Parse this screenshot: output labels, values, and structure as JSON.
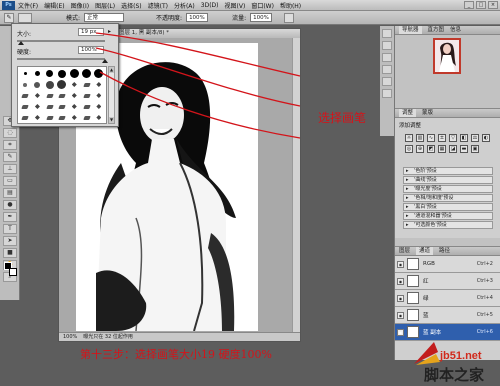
{
  "menubar": {
    "app_badge": "Ps",
    "items": [
      "文件(F)",
      "编辑(E)",
      "图像(I)",
      "图层(L)",
      "选择(S)",
      "滤镜(T)",
      "分析(A)",
      "3D(D)",
      "视图(V)",
      "窗口(W)",
      "帮助(H)"
    ],
    "window_buttons": [
      "_",
      "□",
      "×"
    ]
  },
  "options_bar": {
    "mode_label": "模式:",
    "mode_value": "正常",
    "opacity_label": "不透明度:",
    "opacity_value": "100%",
    "flow_label": "流量:",
    "flow_value": "100%"
  },
  "brush_panel": {
    "size_label": "大小:",
    "size_value": "19 px",
    "hardness_label": "硬度:",
    "hardness_value": "100%",
    "size_fraction": 0.04,
    "hardness_fraction": 1.0
  },
  "document": {
    "title": "图层 1, 黑 副本/8) *",
    "zoom": "100%",
    "status": "曝光只在 32 位起作用"
  },
  "right_panel": {
    "nav_tabs": [
      "导航器",
      "直方图",
      "信息"
    ],
    "adjust_tabs": [
      "调整",
      "蒙版"
    ],
    "adjust_title": "添加调整",
    "presets": [
      "'色阶'预设",
      "'曲线'预设",
      "'曝光度'预设",
      "'色相/饱和度'预设",
      "'黑白'预设",
      "'通道混和器'预设",
      "'可选颜色'预设"
    ],
    "layers_tabs": [
      "图层",
      "通道",
      "路径"
    ],
    "layers": [
      {
        "name": "RGB",
        "shortcut": "Ctrl+2",
        "selected": false
      },
      {
        "name": "红",
        "shortcut": "Ctrl+3",
        "selected": false
      },
      {
        "name": "绿",
        "shortcut": "Ctrl+4",
        "selected": false
      },
      {
        "name": "蓝",
        "shortcut": "Ctrl+5",
        "selected": false
      },
      {
        "name": "蓝 副本",
        "shortcut": "Ctrl+6",
        "selected": true
      }
    ]
  },
  "annotation": {
    "label": "选择画笔",
    "caption": "第十三步：选择画笔大小19  硬度100%"
  },
  "watermark": {
    "site": "jb51.net",
    "name": "脚本之家"
  },
  "colors": {
    "annotation_red": "#d3141a",
    "selection_blue": "#2f5fad",
    "ui_gray": "#bdbdbd"
  }
}
